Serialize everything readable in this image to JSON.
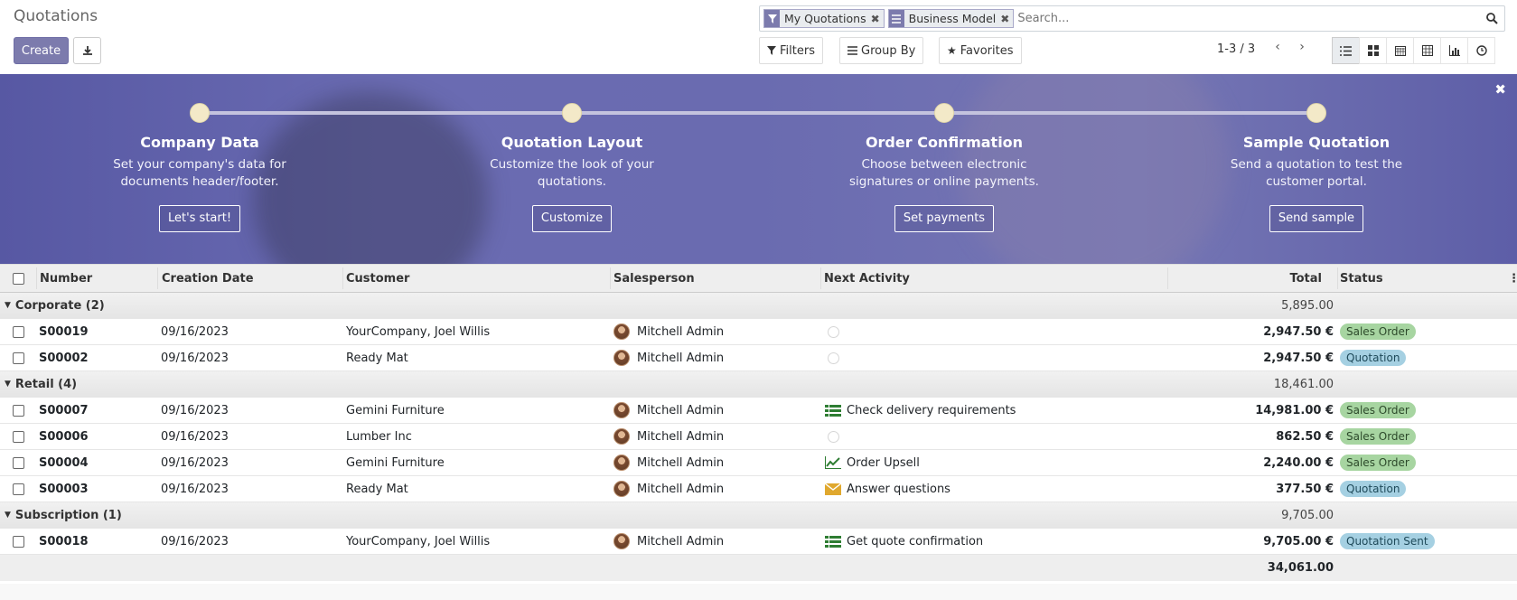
{
  "page": {
    "title": "Quotations"
  },
  "toolbar": {
    "create_label": "Create"
  },
  "search": {
    "facets": [
      {
        "icon": "filter-icon",
        "label": "My Quotations"
      },
      {
        "icon": "group-icon",
        "label": "Business Model"
      }
    ],
    "placeholder": "Search..."
  },
  "controls": {
    "filters": "Filters",
    "group_by": "Group By",
    "favorites": "Favorites"
  },
  "pager": {
    "value": "1-3 / 3"
  },
  "colors": {
    "primary": "#7c7bad",
    "banner": "#6a6bb2",
    "badge_green": "#a7d5a1",
    "badge_blue": "#a5d0e2"
  },
  "banner": {
    "steps": [
      {
        "title": "Company Data",
        "desc1": "Set your company's data for",
        "desc2": "documents header/footer.",
        "button": "Let's start!"
      },
      {
        "title": "Quotation Layout",
        "desc1": "Customize the look of your",
        "desc2": "quotations.",
        "button": "Customize"
      },
      {
        "title": "Order Confirmation",
        "desc1": "Choose between electronic",
        "desc2": "signatures or online payments.",
        "button": "Set payments"
      },
      {
        "title": "Sample Quotation",
        "desc1": "Send a quotation to test the",
        "desc2": "customer portal.",
        "button": "Send sample"
      }
    ]
  },
  "table": {
    "columns": {
      "number": "Number",
      "date": "Creation Date",
      "customer": "Customer",
      "salesperson": "Salesperson",
      "activity": "Next Activity",
      "total": "Total",
      "status": "Status"
    },
    "groups": [
      {
        "label": "Corporate (2)",
        "total": "5,895.00"
      },
      {
        "label": "Retail (4)",
        "total": "18,461.00"
      },
      {
        "label": "Subscription (1)",
        "total": "9,705.00"
      }
    ],
    "rows": [
      {
        "number": "S00019",
        "date": "09/16/2023",
        "customer": "YourCompany, Joel Willis",
        "salesperson": "Mitchell Admin",
        "activity": "",
        "activity_icon": "clock-icon",
        "total": "2,947.50 €",
        "status": "Sales Order"
      },
      {
        "number": "S00002",
        "date": "09/16/2023",
        "customer": "Ready Mat",
        "salesperson": "Mitchell Admin",
        "activity": "",
        "activity_icon": "clock-icon",
        "total": "2,947.50 €",
        "status": "Quotation"
      },
      {
        "number": "S00007",
        "date": "09/16/2023",
        "customer": "Gemini Furniture",
        "salesperson": "Mitchell Admin",
        "activity": "Check delivery requirements",
        "activity_icon": "tasks-icon",
        "total": "14,981.00 €",
        "status": "Sales Order"
      },
      {
        "number": "S00006",
        "date": "09/16/2023",
        "customer": "Lumber Inc",
        "salesperson": "Mitchell Admin",
        "activity": "",
        "activity_icon": "clock-icon",
        "total": "862.50 €",
        "status": "Sales Order"
      },
      {
        "number": "S00004",
        "date": "09/16/2023",
        "customer": "Gemini Furniture",
        "salesperson": "Mitchell Admin",
        "activity": "Order Upsell",
        "activity_icon": "line-chart-icon",
        "total": "2,240.00 €",
        "status": "Sales Order"
      },
      {
        "number": "S00003",
        "date": "09/16/2023",
        "customer": "Ready Mat",
        "salesperson": "Mitchell Admin",
        "activity": "Answer questions",
        "activity_icon": "envelope-icon",
        "total": "377.50 €",
        "status": "Quotation"
      },
      {
        "number": "S00018",
        "date": "09/16/2023",
        "customer": "YourCompany, Joel Willis",
        "salesperson": "Mitchell Admin",
        "activity": "Get quote confirmation",
        "activity_icon": "tasks-icon",
        "total": "9,705.00 €",
        "status": "Quotation Sent"
      }
    ],
    "grand_total": "34,061.00"
  }
}
